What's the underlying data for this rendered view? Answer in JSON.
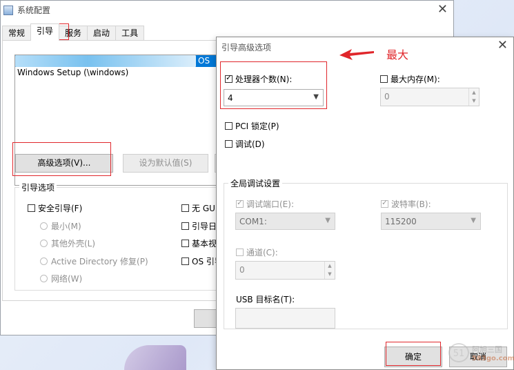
{
  "main_window": {
    "title": "系统配置",
    "close_glyph": "✕",
    "tabs": [
      {
        "label": "常规"
      },
      {
        "label": "引导"
      },
      {
        "label": "服务"
      },
      {
        "label": "启动"
      },
      {
        "label": "工具"
      }
    ],
    "boot_entries": [
      {
        "label": "OS"
      },
      {
        "label": "Windows Setup (\\windows)"
      }
    ],
    "advanced_button": "高级选项(V)...",
    "default_button": "设为默认值(S)",
    "boot_options": {
      "title": "引导选项",
      "safe_boot": "安全引导(F)",
      "minimal": "最小(M)",
      "alternate_shell": "其他外壳(L)",
      "active_directory": "Active Directory 修复(P)",
      "network": "网络(W)",
      "no_gui": "无 GUI",
      "boot_log": "引导日",
      "base_video": "基本视",
      "os_info": "OS 引导"
    }
  },
  "dialog": {
    "title": "引导高级选项",
    "close_glyph": "✕",
    "num_processors": {
      "label": "处理器个数(N):",
      "checked": true,
      "value": "4"
    },
    "max_memory": {
      "label": "最大内存(M):",
      "checked": false,
      "value": "0"
    },
    "pci_lock": {
      "label": "PCI 锁定(P)",
      "checked": false
    },
    "debug": {
      "label": "调试(D)",
      "checked": false
    },
    "global_debug": {
      "title": "全局调试设置",
      "debug_port": {
        "label": "调试端口(E):",
        "checked": true,
        "value": "COM1:"
      },
      "baud_rate": {
        "label": "波特率(B):",
        "checked": true,
        "value": "115200"
      },
      "channel": {
        "label": "通道(C):",
        "checked": false,
        "value": "0"
      },
      "usb_target": {
        "label": "USB 目标名(T):"
      }
    },
    "ok_button": "确定",
    "cancel_button": "取消"
  },
  "annotation": {
    "text": "最大",
    "color": "#e0262b"
  },
  "watermark": {
    "line1": "阿旭三国",
    "line2": "583go.com"
  },
  "colors": {
    "selection": "#0078d7",
    "annotation": "#e0262b"
  }
}
